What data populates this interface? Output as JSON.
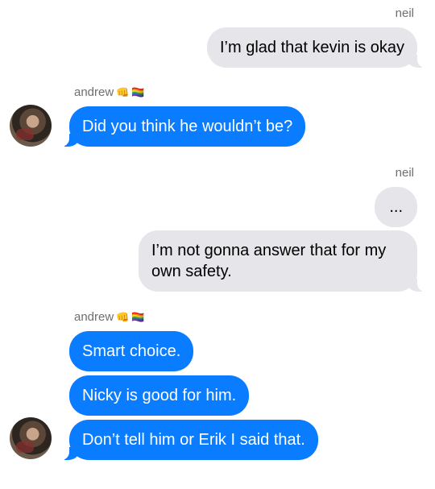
{
  "messages": [
    {
      "type": "sender_name",
      "text": "neil"
    },
    {
      "type": "sent",
      "text": "I’m glad that kevin is okay"
    },
    {
      "type": "sender_name",
      "text": "andrew"
    },
    {
      "type": "received",
      "text": "Did you think he wouldn’t be?"
    },
    {
      "type": "sender_name",
      "text": "neil"
    },
    {
      "type": "sent",
      "text": "..."
    },
    {
      "type": "sent",
      "text": "I’m not gonna answer that for my own safety."
    },
    {
      "type": "sender_name",
      "text": "andrew"
    },
    {
      "type": "received",
      "text": "Smart choice."
    },
    {
      "type": "received",
      "text": "Nicky is good for him."
    },
    {
      "type": "received",
      "text": "Don’t tell him or Erik I said that."
    }
  ],
  "contacts": {
    "neil": {
      "name": "neil"
    },
    "andrew": {
      "name": "andrew",
      "emoji": [
        "👊",
        "🏳️‍🌈"
      ]
    }
  },
  "colors": {
    "sent_bubble": "#e5e5ea",
    "received_bubble": "#0a7cff",
    "received_text": "#ffffff",
    "sent_text": "#000000",
    "name_text": "#6e6e73"
  }
}
